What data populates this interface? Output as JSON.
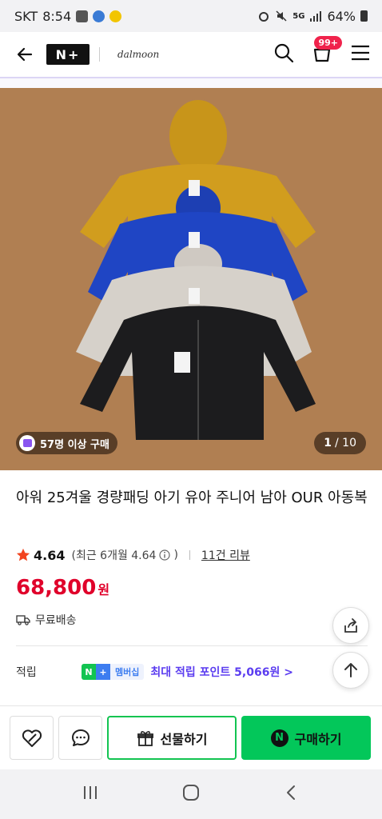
{
  "status_bar": {
    "carrier": "SKT",
    "time": "8:54",
    "network": "5G",
    "battery": "64%"
  },
  "header": {
    "logo_text": "N+",
    "brand_name": "dalmoon",
    "cart_badge": "99+"
  },
  "product_image": {
    "buyers_badge": "57명 이상 구매",
    "page_current": "1",
    "page_total": "/ 10"
  },
  "product": {
    "title": "아워 25겨울 경량패딩 아기 유아 주니어 남아 OUR 아동복",
    "rating": "4.64",
    "rating_note": "(최근 6개월 4.64",
    "rating_note_end": ")",
    "review_link": "11건 리뷰",
    "price": "68,800",
    "price_unit": "원",
    "shipping": "무료배송"
  },
  "points": {
    "label": "적립",
    "badge_n": "N",
    "badge_plus": "+",
    "badge_text": "멤버십",
    "text": "최대 적립 포인트 5,066원 >"
  },
  "bottom_bar": {
    "gift_label": "선물하기",
    "buy_label": "구매하기",
    "buy_icon_text": "N"
  },
  "colors": {
    "price_red": "#e0002a",
    "naver_green": "#03c75a",
    "points_purple": "#5b3df0",
    "image_bg": "#b07f52"
  },
  "icons": [
    "back-arrow-icon",
    "search-icon",
    "cart-icon",
    "menu-icon",
    "star-icon",
    "info-icon",
    "truck-icon",
    "share-icon",
    "arrow-up-icon",
    "wishlist-icon",
    "chat-icon",
    "gift-icon"
  ]
}
